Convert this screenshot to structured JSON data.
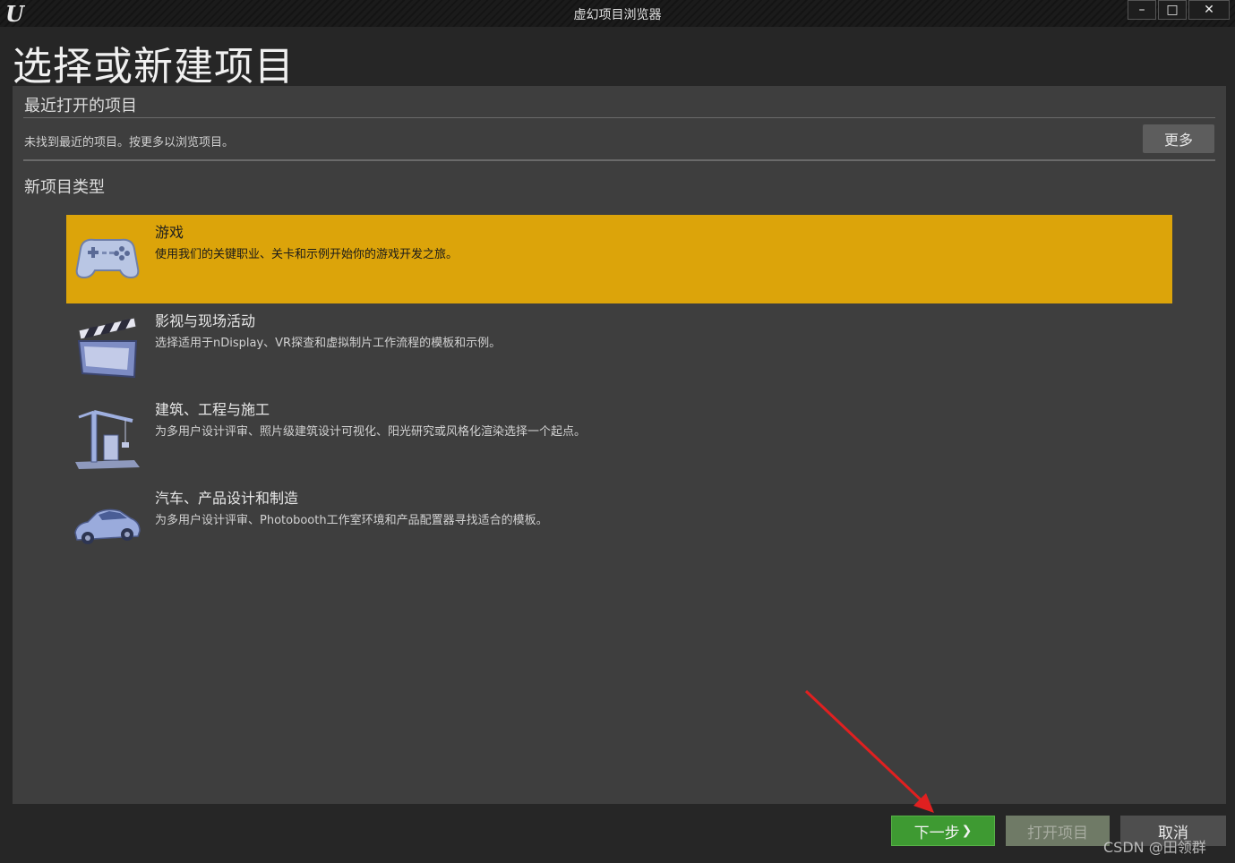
{
  "window": {
    "title": "虚幻项目浏览器",
    "logo": "U"
  },
  "headline": "选择或新建项目",
  "recent": {
    "title": "最近打开的项目",
    "empty_message": "未找到最近的项目。按更多以浏览项目。",
    "more_button": "更多"
  },
  "new_project": {
    "title": "新项目类型",
    "categories": [
      {
        "name": "游戏",
        "desc": "使用我们的关键职业、关卡和示例开始你的游戏开发之旅。",
        "icon": "gamepad-icon",
        "selected": true
      },
      {
        "name": "影视与现场活动",
        "desc": "选择适用于nDisplay、VR探查和虚拟制片工作流程的模板和示例。",
        "icon": "clapperboard-icon",
        "selected": false
      },
      {
        "name": "建筑、工程与施工",
        "desc": "为多用户设计评审、照片级建筑设计可视化、阳光研究或风格化渲染选择一个起点。",
        "icon": "crane-icon",
        "selected": false
      },
      {
        "name": "汽车、产品设计和制造",
        "desc": "为多用户设计评审、Photobooth工作室环境和产品配置器寻找适合的模板。",
        "icon": "car-icon",
        "selected": false
      }
    ]
  },
  "buttons": {
    "next": "下一步",
    "open": "打开项目",
    "cancel": "取消"
  },
  "watermark": "CSDN @田领群",
  "colors": {
    "selected": "#dca40a",
    "next": "#3e9a32",
    "annotation_arrow": "#e02020"
  }
}
